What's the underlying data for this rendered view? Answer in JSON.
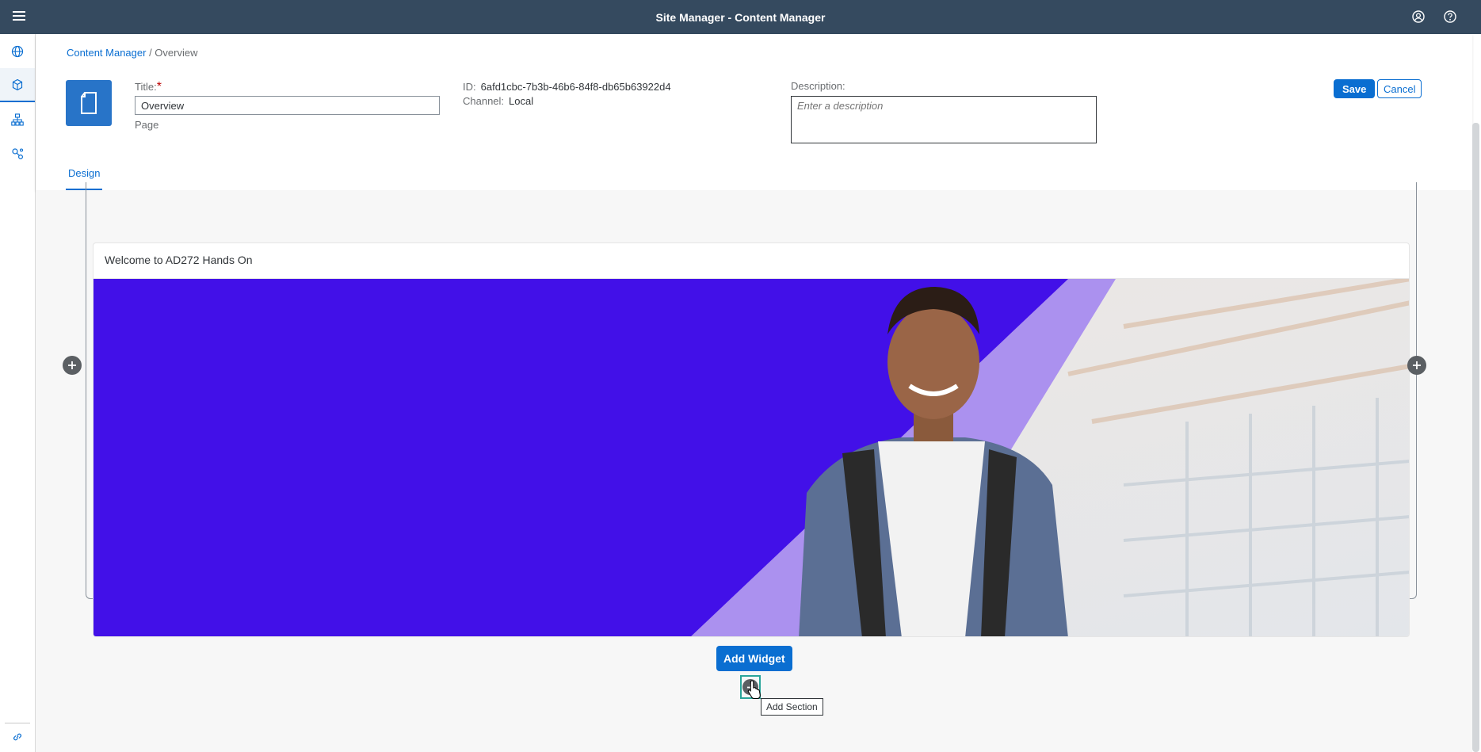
{
  "shell": {
    "title": "Site Manager - Content Manager",
    "icons": [
      "menu-icon",
      "user-icon",
      "help-icon"
    ]
  },
  "sidenav": {
    "items": [
      {
        "icon": "globe-icon",
        "active": false
      },
      {
        "icon": "cube-icon",
        "active": true
      },
      {
        "icon": "hierarchy-icon",
        "active": false
      },
      {
        "icon": "settings-network-icon",
        "active": false
      }
    ],
    "bottom_icon": "link-icon"
  },
  "breadcrumb": {
    "link": "Content Manager",
    "separator": " / ",
    "current": "Overview"
  },
  "page": {
    "icon": "document-icon",
    "title_label": "Title:",
    "title_required": "*",
    "title_value": "Overview",
    "type": "Page",
    "id_label": "ID:",
    "id_value": "6afd1cbc-7b3b-46b6-84f8-db65b63922d4",
    "channel_label": "Channel:",
    "channel_value": "Local",
    "description_label": "Description:",
    "description_placeholder": "Enter a description",
    "save": "Save",
    "cancel": "Cancel"
  },
  "tabs": [
    {
      "label": "Design",
      "active": true
    }
  ],
  "widget": {
    "title": "Welcome to AD272 Hands On",
    "image": "banner-student-with-backpack"
  },
  "actions": {
    "add_widget": "Add Widget",
    "add_section_tooltip": "Add Section"
  },
  "colors": {
    "shell": "#354a5f",
    "accent": "#0a6ed1",
    "banner": "#4210e8",
    "highlight": "#2aa59a"
  }
}
